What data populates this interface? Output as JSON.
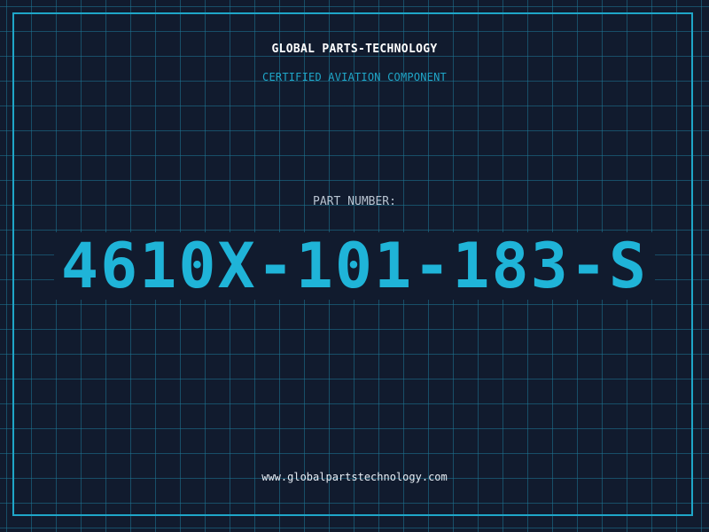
{
  "header": {
    "company": "GLOBAL PARTS-TECHNOLOGY",
    "tagline": "CERTIFIED AVIATION COMPONENT"
  },
  "part": {
    "label": "PART NUMBER:",
    "number": "4610X-101-183-S"
  },
  "footer": {
    "website": "www.globalpartstechnology.com"
  },
  "colors": {
    "background": "#111b2e",
    "grid": "#1e7896",
    "accent": "#1fb4d8",
    "frame": "#1fa6c8"
  }
}
